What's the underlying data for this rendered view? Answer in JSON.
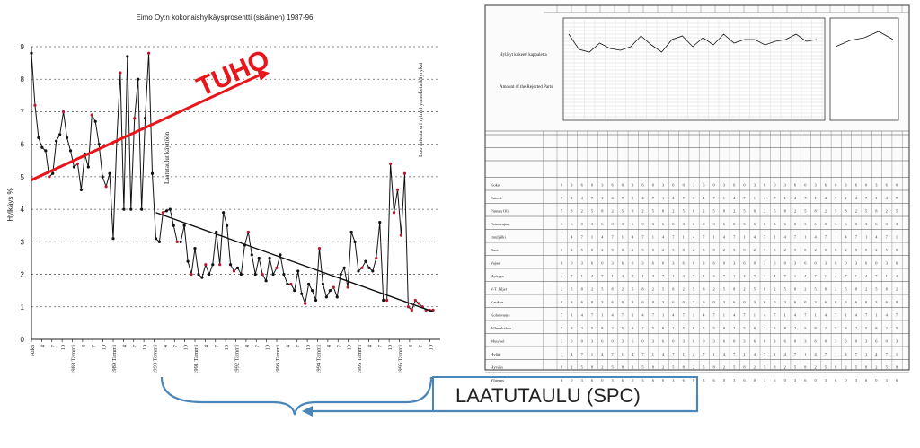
{
  "chart_data": {
    "type": "line",
    "title": "Eimo Oy:n kokonaishylkäysprosentti (sisäinen)  1987-96",
    "ylabel": "Hylkäys %",
    "ylim": [
      0,
      9
    ],
    "yticks": [
      "0",
      "1",
      "2",
      "3",
      "4",
      "5",
      "6",
      "7",
      "8",
      "9"
    ],
    "xticks": [
      "Aika",
      "4",
      "7",
      "10",
      "1988 Tammi",
      "4",
      "7",
      "10",
      "1989 Tammi",
      "4",
      "7",
      "10",
      "1990 Tammi",
      "4",
      "7",
      "10",
      "1991 Tammi",
      "4",
      "7",
      "10",
      "1992 Tammi",
      "4",
      "7",
      "10",
      "1993 Tammi",
      "4",
      "7",
      "10",
      "1994 Tammi",
      "4",
      "7",
      "10",
      "1995 Tammi",
      "4",
      "7",
      "10",
      "1996 Tammi",
      "4",
      "7",
      "10"
    ],
    "x_months": [
      0,
      1,
      2,
      3,
      4,
      5,
      6,
      7,
      8,
      9,
      10,
      11,
      12,
      13,
      14,
      15,
      16,
      17,
      18,
      19,
      20,
      21,
      22,
      23,
      24,
      25,
      26,
      27,
      28,
      29,
      30,
      31,
      32,
      33,
      34,
      35,
      36,
      37,
      38,
      39,
      40,
      41,
      42,
      43,
      44,
      45,
      46,
      47,
      48,
      49,
      50,
      51,
      52,
      53,
      54,
      55,
      56,
      57,
      58,
      59,
      60,
      61,
      62,
      63,
      64,
      65,
      66,
      67,
      68,
      69,
      70,
      71,
      72,
      73,
      74,
      75,
      76,
      77,
      78,
      79,
      80,
      81,
      82,
      83,
      84,
      85,
      86,
      87,
      88,
      89,
      90,
      91,
      92,
      93,
      94,
      95,
      96,
      97,
      98,
      99,
      100,
      101,
      102,
      103,
      104,
      105,
      106,
      107,
      108,
      109,
      110,
      111,
      112,
      113
    ],
    "values": [
      8.8,
      7.2,
      6.2,
      5.9,
      5.8,
      5.0,
      5.1,
      6.1,
      6.3,
      7.0,
      6.2,
      5.8,
      5.3,
      5.4,
      4.6,
      5.7,
      5.3,
      6.9,
      6.7,
      6.0,
      5.0,
      4.7,
      5.1,
      3.1,
      6.1,
      8.2,
      4.0,
      8.7,
      4.0,
      6.8,
      8.0,
      4.0,
      6.8,
      8.8,
      5.1,
      3.1,
      3.0,
      3.9,
      3.95,
      4.0,
      3.5,
      3.0,
      3.0,
      3.5,
      2.4,
      2.0,
      2.8,
      2.0,
      1.9,
      2.3,
      2.0,
      2.3,
      3.3,
      2.3,
      3.9,
      3.5,
      2.3,
      2.1,
      2.2,
      2.0,
      2.9,
      3.3,
      2.6,
      2.0,
      2.5,
      2.0,
      1.8,
      2.5,
      2.0,
      2.2,
      2.6,
      2.0,
      1.7,
      1.7,
      1.5,
      2.1,
      1.4,
      1.1,
      1.7,
      1.5,
      1.2,
      2.8,
      1.7,
      1.3,
      1.5,
      1.6,
      1.3,
      2.0,
      2.2,
      1.6,
      3.3,
      3.0,
      2.1,
      2.2,
      2.4,
      2.2,
      2.1,
      2.5,
      3.6,
      1.2,
      1.2,
      5.4,
      3.9,
      4.6,
      3.2,
      5.1,
      1.0,
      0.9,
      1.2,
      1.1,
      1.0,
      0.9,
      0.9,
      0.9
    ],
    "trend_tuho": {
      "from": [
        0,
        4.9
      ],
      "to": [
        66,
        8.2
      ]
    },
    "trend_down": {
      "from": [
        35,
        3.9
      ],
      "to": [
        113,
        0.85
      ]
    },
    "annotations": [
      {
        "text": "TUHO",
        "color": "#e8151b"
      },
      {
        "text": "Laatutaulut käyttöön"
      },
      {
        "text": "Luo asiesta eri rytmti yrmoketa käyryksi"
      }
    ],
    "grid": true
  },
  "tuho_label": "TUHO",
  "annot_laatu": "Laatutaulut käyttöön",
  "annot_right": "Luo asiesta eri rytmti yrmoketa käyryksi",
  "spc_label": "LAATUTAULU (SPC)",
  "form": {
    "row_labels": [
      "Hylätyt kokeet/ kappaletta",
      "Amount of the Rejected Parts"
    ],
    "categories": [
      "Koko",
      "Enterit",
      "Pinnan Oli",
      "Painovajaat",
      "Imuljälki",
      "Raot",
      "Vajaa",
      "Hyisyys",
      "V-T Jäljet",
      "Kaukke",
      "Kolonvaure",
      "Alleenkahaa",
      "Muu/kel",
      "Hylätt",
      "Hyväks",
      "Yhteens"
    ]
  },
  "colors": {
    "red": "#e8151b",
    "axis": "#222222",
    "grid": "#666666",
    "blue": "#4a86b8",
    "marker": "#c0142b"
  }
}
